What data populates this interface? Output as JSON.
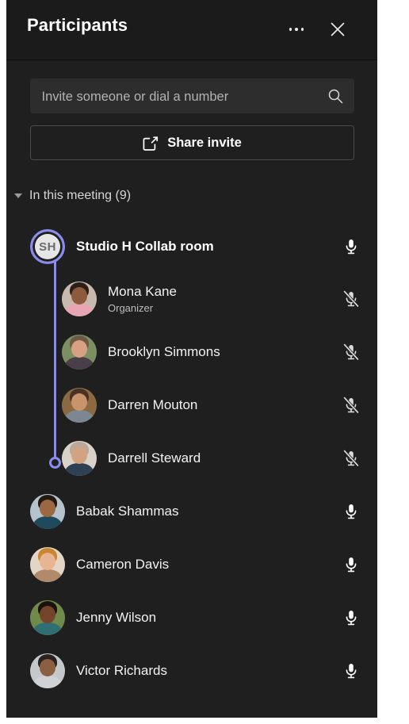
{
  "panel": {
    "title": "Participants",
    "more_options_label": "More options",
    "close_label": "Close"
  },
  "invite": {
    "search_placeholder": "Invite someone or dial a number",
    "search_value": "",
    "search_icon": "search-icon",
    "share_label": "Share invite",
    "share_icon": "share-icon"
  },
  "section": {
    "label": "In this meeting (9)",
    "chevron_icon": "chevron-down-icon",
    "count": 9,
    "expanded": true
  },
  "colors": {
    "panel_background": "#1f1f1f",
    "header_background": "#1b1b1b",
    "search_background": "#2d2d2d",
    "accent_purple": "#8a8af0",
    "primary_text": "#ffffff",
    "secondary_text": "#bdbdbd"
  },
  "room": {
    "name": "Studio H Collab room",
    "initials": "SH",
    "mic_icon": "microphone-icon",
    "muted": false
  },
  "participants": [
    {
      "name": "Mona Kane",
      "role": "Organizer",
      "nested": true,
      "muted": true,
      "mic_icon": "microphone-muted-icon",
      "avatar": "avatar-mona-kane",
      "bg": "#c9b8ae",
      "hair": "#2b1d17",
      "skin": "#8d5a3c",
      "body": "#e8a6b4"
    },
    {
      "name": "Brooklyn Simmons",
      "role": "",
      "nested": true,
      "muted": true,
      "mic_icon": "microphone-muted-icon",
      "avatar": "avatar-brooklyn-simmons",
      "bg": "#7b8f63",
      "hair": "#6b5a44",
      "skin": "#d9a183",
      "body": "#4a3f48"
    },
    {
      "name": "Darren Mouton",
      "role": "",
      "nested": true,
      "muted": true,
      "mic_icon": "microphone-muted-icon",
      "avatar": "avatar-darren-mouton",
      "bg": "#8a6a40",
      "hair": "#4a3326",
      "skin": "#c9936b",
      "body": "#7d8794"
    },
    {
      "name": "Darrell Steward",
      "role": "",
      "nested": true,
      "muted": true,
      "mic_icon": "microphone-muted-icon",
      "avatar": "avatar-darrell-steward",
      "bg": "#d9d2c8",
      "hair": "#b9a99a",
      "skin": "#d2a381",
      "body": "#2e4154"
    },
    {
      "name": "Babak Shammas",
      "role": "",
      "nested": false,
      "muted": false,
      "mic_icon": "microphone-icon",
      "avatar": "avatar-babak-shammas",
      "bg": "#b7c3cc",
      "hair": "#241a14",
      "skin": "#9c6844",
      "body": "#1f4a5e"
    },
    {
      "name": "Cameron Davis",
      "role": "",
      "nested": false,
      "muted": false,
      "mic_icon": "microphone-icon",
      "avatar": "avatar-cameron-davis",
      "bg": "#e4d6c6",
      "hair": "#c9852f",
      "skin": "#e8b592",
      "body": "#b08a6a"
    },
    {
      "name": "Jenny Wilson",
      "role": "",
      "nested": false,
      "muted": false,
      "mic_icon": "microphone-icon",
      "avatar": "avatar-jenny-wilson",
      "bg": "#6f8a4a",
      "hair": "#1a120d",
      "skin": "#74452a",
      "body": "#2f6e72"
    },
    {
      "name": "Victor Richards",
      "role": "",
      "nested": false,
      "muted": false,
      "mic_icon": "microphone-icon",
      "avatar": "avatar-victor-richards",
      "bg": "#c4c8cb",
      "hair": "#2a2320",
      "skin": "#8a5f42",
      "body": "#cfd3d6"
    }
  ]
}
